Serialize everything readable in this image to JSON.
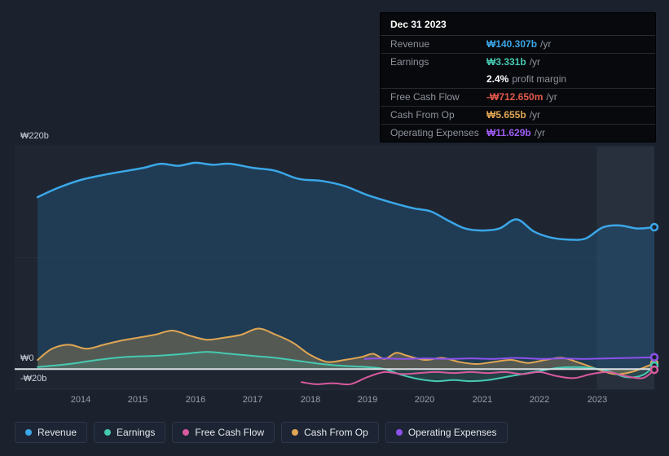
{
  "tooltip": {
    "date": "Dec 31 2023",
    "rows": [
      {
        "label": "Revenue",
        "value": "₩140.307b",
        "suffix": "/yr",
        "color": "#3ba7e8",
        "divider": false
      },
      {
        "label": "Earnings",
        "value": "₩3.331b",
        "suffix": "/yr",
        "color": "#46c9b1",
        "divider": true
      },
      {
        "label": "",
        "value": "2.4%",
        "suffix": "profit margin",
        "color": "#ffffff",
        "divider": false
      },
      {
        "label": "Free Cash Flow",
        "value": "-₩712.650m",
        "suffix": "/yr",
        "color": "#e2584a",
        "divider": true
      },
      {
        "label": "Cash From Op",
        "value": "₩5.655b",
        "suffix": "/yr",
        "color": "#e0a653",
        "divider": true
      },
      {
        "label": "Operating Expenses",
        "value": "₩11.629b",
        "suffix": "/yr",
        "color": "#9c5cf0",
        "divider": true
      }
    ]
  },
  "legend": {
    "items": [
      {
        "label": "Revenue",
        "color": "#3ba7e8"
      },
      {
        "label": "Earnings",
        "color": "#46c9b1"
      },
      {
        "label": "Free Cash Flow",
        "color": "#d95a9e"
      },
      {
        "label": "Cash From Op",
        "color": "#e0a653"
      },
      {
        "label": "Operating Expenses",
        "color": "#8c52ec"
      }
    ]
  },
  "chart_data": {
    "type": "area",
    "title": "Financial history: revenue, earnings and cash flow over time",
    "xlabel": "",
    "ylabel": "",
    "xlim": [
      2012.85,
      2024.0
    ],
    "ylim": [
      -20,
      220
    ],
    "grid": {
      "y_values": [
        220,
        110,
        -20
      ]
    },
    "y_ticks": [
      {
        "value": 220,
        "label": "₩220b"
      },
      {
        "value": 0,
        "label": "₩0"
      },
      {
        "value": -20,
        "label": "-₩20b"
      }
    ],
    "x_ticks": [
      {
        "value": 2014,
        "label": "2014"
      },
      {
        "value": 2015,
        "label": "2015"
      },
      {
        "value": 2016,
        "label": "2016"
      },
      {
        "value": 2017,
        "label": "2017"
      },
      {
        "value": 2018,
        "label": "2018"
      },
      {
        "value": 2019,
        "label": "2019"
      },
      {
        "value": 2020,
        "label": "2020"
      },
      {
        "value": 2021,
        "label": "2021"
      },
      {
        "value": 2022,
        "label": "2022"
      },
      {
        "value": 2023,
        "label": "2023"
      }
    ],
    "highlight_band": {
      "from": 2023,
      "to": 2024.0
    },
    "series": [
      {
        "name": "Revenue",
        "color": "#3ba7e8",
        "fill": "rgba(33,112,165,0.30)",
        "points": [
          [
            2013.25,
            170
          ],
          [
            2013.6,
            179
          ],
          [
            2014,
            187
          ],
          [
            2014.4,
            192
          ],
          [
            2014.8,
            196
          ],
          [
            2015.1,
            199
          ],
          [
            2015.4,
            203
          ],
          [
            2015.7,
            201
          ],
          [
            2016,
            204
          ],
          [
            2016.3,
            202
          ],
          [
            2016.6,
            203
          ],
          [
            2017,
            199
          ],
          [
            2017.4,
            196
          ],
          [
            2017.8,
            188
          ],
          [
            2018.2,
            186
          ],
          [
            2018.6,
            181
          ],
          [
            2019,
            172
          ],
          [
            2019.4,
            165
          ],
          [
            2019.8,
            159
          ],
          [
            2020.1,
            156
          ],
          [
            2020.4,
            147
          ],
          [
            2020.7,
            139
          ],
          [
            2021,
            137
          ],
          [
            2021.3,
            139
          ],
          [
            2021.6,
            148
          ],
          [
            2021.9,
            136
          ],
          [
            2022.2,
            130
          ],
          [
            2022.5,
            128
          ],
          [
            2022.8,
            129
          ],
          [
            2023.1,
            140
          ],
          [
            2023.4,
            142
          ],
          [
            2023.7,
            139
          ],
          [
            2024,
            140.307
          ]
        ]
      },
      {
        "name": "Cash From Op",
        "color": "#e0a653",
        "fill": "rgba(224,166,83,0.28)",
        "points": [
          [
            2013.25,
            9
          ],
          [
            2013.5,
            20
          ],
          [
            2013.8,
            24
          ],
          [
            2014.1,
            20
          ],
          [
            2014.4,
            24
          ],
          [
            2014.7,
            28
          ],
          [
            2015,
            31
          ],
          [
            2015.3,
            34
          ],
          [
            2015.6,
            38
          ],
          [
            2015.9,
            33
          ],
          [
            2016.2,
            29
          ],
          [
            2016.5,
            31
          ],
          [
            2016.8,
            34
          ],
          [
            2017.1,
            40
          ],
          [
            2017.4,
            34
          ],
          [
            2017.7,
            26
          ],
          [
            2018,
            14
          ],
          [
            2018.3,
            7
          ],
          [
            2018.6,
            9
          ],
          [
            2018.9,
            12
          ],
          [
            2019.1,
            15
          ],
          [
            2019.3,
            10
          ],
          [
            2019.5,
            16
          ],
          [
            2019.7,
            13
          ],
          [
            2020,
            9
          ],
          [
            2020.3,
            11
          ],
          [
            2020.6,
            7
          ],
          [
            2020.9,
            5
          ],
          [
            2021.2,
            7
          ],
          [
            2021.5,
            9
          ],
          [
            2021.8,
            6
          ],
          [
            2022.1,
            9
          ],
          [
            2022.4,
            11
          ],
          [
            2022.7,
            6
          ],
          [
            2023,
            0
          ],
          [
            2023.3,
            -5
          ],
          [
            2023.6,
            -3
          ],
          [
            2024,
            5.655
          ]
        ]
      },
      {
        "name": "Earnings",
        "color": "#46c9b1",
        "fill": "rgba(70,201,177,0.16)",
        "points": [
          [
            2013.25,
            2
          ],
          [
            2013.8,
            5
          ],
          [
            2014.3,
            9
          ],
          [
            2014.8,
            12
          ],
          [
            2015.3,
            13
          ],
          [
            2015.8,
            15
          ],
          [
            2016.2,
            17
          ],
          [
            2016.6,
            15
          ],
          [
            2017,
            13
          ],
          [
            2017.4,
            11
          ],
          [
            2017.8,
            8
          ],
          [
            2018.2,
            5
          ],
          [
            2018.6,
            3
          ],
          [
            2019,
            2
          ],
          [
            2019.3,
            0
          ],
          [
            2019.6,
            -6
          ],
          [
            2019.9,
            -10
          ],
          [
            2020.2,
            -12
          ],
          [
            2020.5,
            -11
          ],
          [
            2020.8,
            -12
          ],
          [
            2021.1,
            -11
          ],
          [
            2021.4,
            -8
          ],
          [
            2021.7,
            -5
          ],
          [
            2022,
            -2
          ],
          [
            2022.3,
            1
          ],
          [
            2022.6,
            2
          ],
          [
            2022.9,
            1
          ],
          [
            2023.2,
            -2
          ],
          [
            2023.5,
            -8
          ],
          [
            2023.8,
            -6
          ],
          [
            2024,
            3.331
          ]
        ]
      },
      {
        "name": "Free Cash Flow",
        "color": "#d95a9e",
        "fill": "none",
        "points": [
          [
            2017.85,
            -13
          ],
          [
            2018.1,
            -15
          ],
          [
            2018.4,
            -14
          ],
          [
            2018.7,
            -15
          ],
          [
            2019,
            -8
          ],
          [
            2019.3,
            -3
          ],
          [
            2019.6,
            -5
          ],
          [
            2019.9,
            -4
          ],
          [
            2020.2,
            -3
          ],
          [
            2020.5,
            -4
          ],
          [
            2020.8,
            -3
          ],
          [
            2021.1,
            -4
          ],
          [
            2021.4,
            -3
          ],
          [
            2021.7,
            -5
          ],
          [
            2022,
            -3
          ],
          [
            2022.3,
            -7
          ],
          [
            2022.6,
            -9
          ],
          [
            2022.9,
            -5
          ],
          [
            2023.2,
            -3
          ],
          [
            2023.5,
            -7
          ],
          [
            2023.8,
            -9
          ],
          [
            2024,
            -0.713
          ]
        ]
      },
      {
        "name": "Operating Expenses",
        "color": "#8c52ec",
        "fill": "none",
        "points": [
          [
            2018.95,
            10
          ],
          [
            2019.3,
            10.5
          ],
          [
            2019.6,
            10
          ],
          [
            2020,
            10.5
          ],
          [
            2020.4,
            10
          ],
          [
            2020.8,
            10.5
          ],
          [
            2021.2,
            10
          ],
          [
            2021.6,
            11
          ],
          [
            2022,
            10
          ],
          [
            2022.4,
            10.5
          ],
          [
            2022.8,
            10
          ],
          [
            2023.2,
            10.5
          ],
          [
            2023.6,
            11
          ],
          [
            2024,
            11.629
          ]
        ]
      }
    ]
  }
}
